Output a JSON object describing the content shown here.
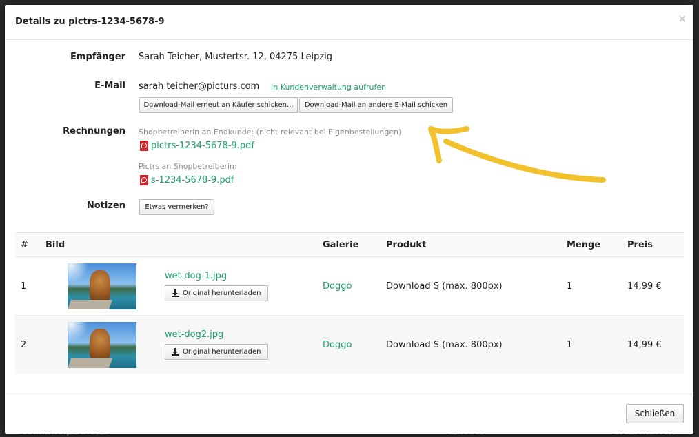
{
  "modal": {
    "title": "Details zu pictrs-1234-5678-9",
    "close_glyph": "×"
  },
  "details": {
    "recipient_label": "Empfänger",
    "recipient_value": "Sarah Teicher, Mustertsr. 12, 04275 Leipzig",
    "email_label": "E-Mail",
    "email_value": "sarah.teicher@picturs.com",
    "customer_link": "In Kundenverwaltung aufrufen",
    "resend_button": "Download-Mail erneut an Käufer schicken...",
    "other_mail_button": "Download-Mail an andere E-Mail schicken",
    "invoices_label": "Rechnungen",
    "invoice1_caption": "Shopbetreiberin an Endkunde: (nicht relevant bei Eigenbestellungen)",
    "invoice1_file": "pictrs-1234-5678-9.pdf",
    "invoice2_caption": "Pictrs an Shopbetreiberin:",
    "invoice2_file": "s-1234-5678-9.pdf",
    "notes_label": "Notizen",
    "notes_button": "Etwas vermerken?"
  },
  "table": {
    "headers": [
      "#",
      "Bild",
      "Galerie",
      "Produkt",
      "Menge",
      "Preis"
    ],
    "rows": [
      {
        "num": "1",
        "file": "wet-dog-1.jpg",
        "download": "Original herunterladen",
        "gallery": "Doggo",
        "product": "Download S (max. 800px)",
        "qty": "1",
        "price": "14,99 €"
      },
      {
        "num": "2",
        "file": "wet-dog2.jpg",
        "download": "Original herunterladen",
        "gallery": "Doggo",
        "product": "Download S (max. 800px)",
        "qty": "1",
        "price": "14,99 €"
      }
    ]
  },
  "footer": {
    "close_button": "Schließen"
  },
  "backdrop": {
    "left_text": "Gesammer, Galerie",
    "mid_text": "Umsatz",
    "right_text": "Sie erhalten"
  },
  "colors": {
    "accent_green": "#1aa06a",
    "arrow_yellow": "#f2c12e",
    "pdf_red": "#d32525"
  }
}
